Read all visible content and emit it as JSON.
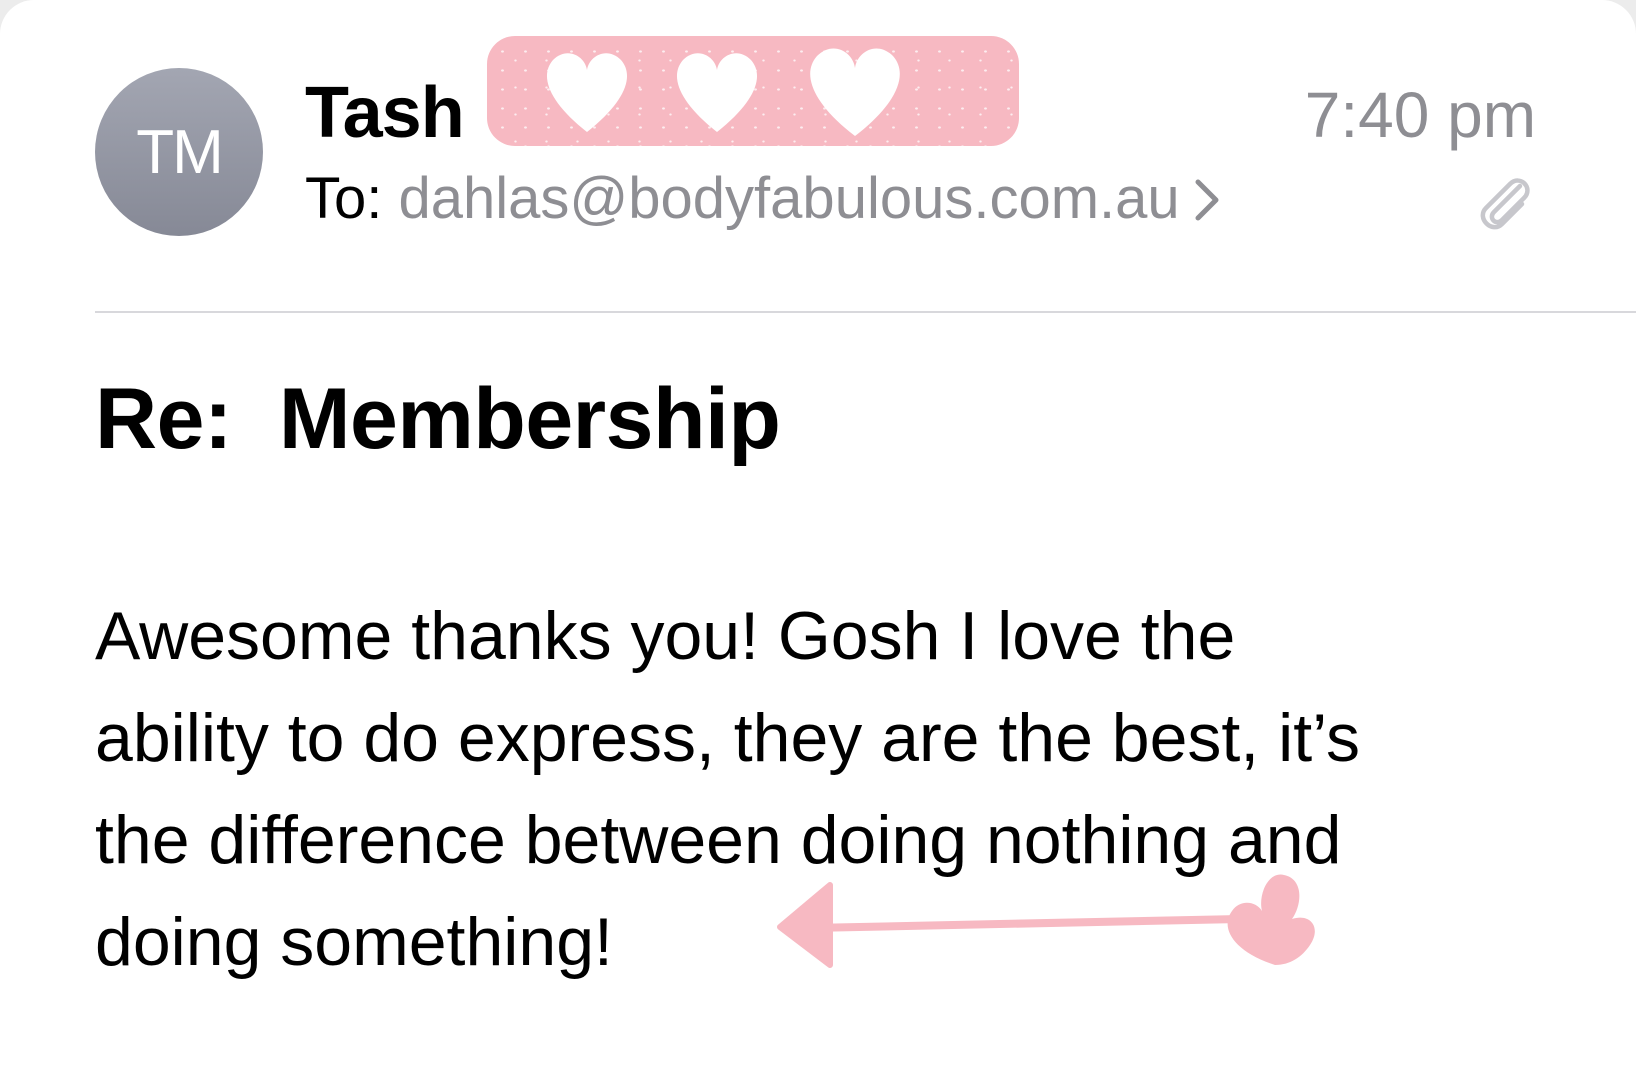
{
  "header": {
    "avatar_initials": "TM",
    "sender_name": "Tash",
    "time": "7:40 pm",
    "to_label": "To: ",
    "to_address": "dahlas@bodyfabulous.com.au",
    "icons": {
      "disclosure": "chevron-right-icon",
      "attachment": "paperclip-icon"
    }
  },
  "email": {
    "subject": "Re:  Membership",
    "body_lines": [
      "Awesome thanks you! Gosh I love the",
      "ability to do express, they are the best, it’s",
      "the difference between doing nothing and",
      "doing something!"
    ]
  },
  "decorations": {
    "redaction_color": "#f7b9c2",
    "doodle_color": "#f7b9c2",
    "heart_count": 3
  },
  "colors": {
    "secondary_text": "#8e8e93",
    "divider": "#d8d8dc",
    "avatar": "#9a9daa"
  }
}
